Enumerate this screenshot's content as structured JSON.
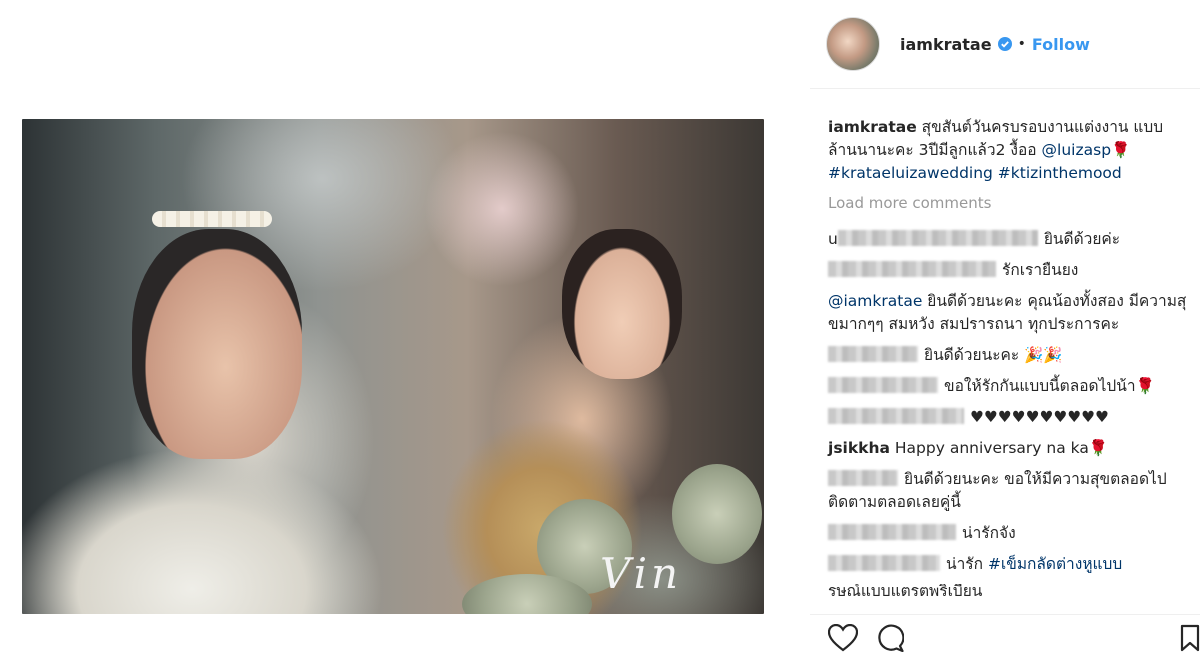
{
  "post": {
    "username": "iamkratae",
    "follow_label": "Follow",
    "dot": "•",
    "watermark": "Vin"
  },
  "caption": {
    "username": "iamkratae",
    "text": " สุขสันต์วันครบรอบงานแต่งงาน แบบล้านนานะคะ 3ปีมีลูกแล้ว2 งื้ออ ",
    "mention": "@luizasp",
    "mention_emoji": "🌹",
    "hashtags": "#krataeluizawedding #ktizinthemood"
  },
  "load_more": "Load more comments",
  "comments": [
    {
      "user_hidden": true,
      "prefix": "u",
      "text": "ยินดีด้วยค่ะ"
    },
    {
      "user_hidden": true,
      "prefix": "",
      "text": "รักเรายืนยง"
    },
    {
      "user_hidden": false,
      "prefix": "",
      "mention": "@iamkratae",
      "text": " ยินดีด้วยนะคะ คุณน้องทั้งสอง มีความสุขมากๆๆ สมหวัง สมปรารถนา ทุกประการคะ"
    },
    {
      "user_hidden": true,
      "prefix": "",
      "text": "ยินดีด้วยนะคะ 🎉🎉"
    },
    {
      "user_hidden": true,
      "prefix": "",
      "text": "ขอให้รักกันแบบนี้ตลอดไปน้า🌹"
    },
    {
      "user_hidden": true,
      "prefix": "",
      "text": "♥♥♥♥♥♥♥♥♥♥"
    },
    {
      "user_hidden": false,
      "user": "jsikkha",
      "text": " Happy anniversary na ka🌹"
    },
    {
      "user_hidden": true,
      "prefix": "",
      "text": "ยินดีด้วยนะคะ ขอให้มีความสุขตลอดไป ติดตามตลอดเลยคู่นี้"
    },
    {
      "user_hidden": true,
      "prefix": "",
      "text": "น่ารักจัง"
    },
    {
      "user_hidden": true,
      "prefix": "",
      "text": "น่ารัก ",
      "hashtag": "#เข็มกลัดต่างหูแบบ"
    },
    {
      "partial": "รษณ์แบบแตรตพริเบียน"
    }
  ],
  "icons": {
    "like": "heart-icon",
    "comment": "comment-icon",
    "save": "bookmark-icon",
    "verified": "verified-badge-icon"
  },
  "colors": {
    "link": "#003569",
    "follow": "#3897f0",
    "verified": "#3897f0",
    "muted": "#999999"
  }
}
